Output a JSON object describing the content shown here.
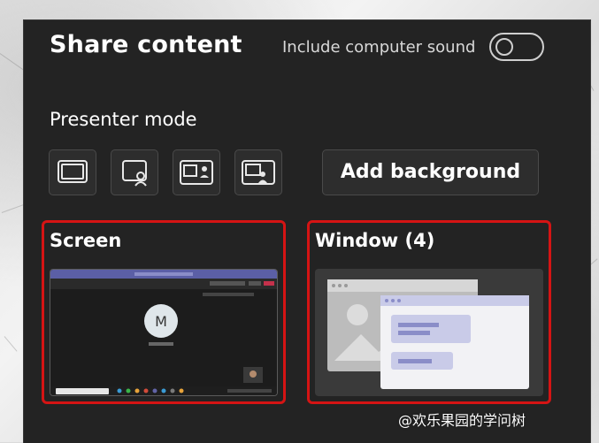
{
  "dialog": {
    "title": "Share content",
    "include_sound_label": "Include computer sound",
    "include_sound_on": false
  },
  "presenter": {
    "label": "Presenter mode",
    "modes": [
      {
        "icon": "content-only-icon"
      },
      {
        "icon": "standout-icon"
      },
      {
        "icon": "side-by-side-icon"
      },
      {
        "icon": "reporter-icon"
      }
    ],
    "add_background_label": "Add background"
  },
  "sources": {
    "screen": {
      "label": "Screen",
      "preview_avatar": "M"
    },
    "window": {
      "label": "Window (4)"
    }
  },
  "watermark": "@欢乐果园的学问树",
  "colors": {
    "panel": "#232323",
    "selected_border": "#d51414",
    "accent_purple": "#6264a7"
  }
}
